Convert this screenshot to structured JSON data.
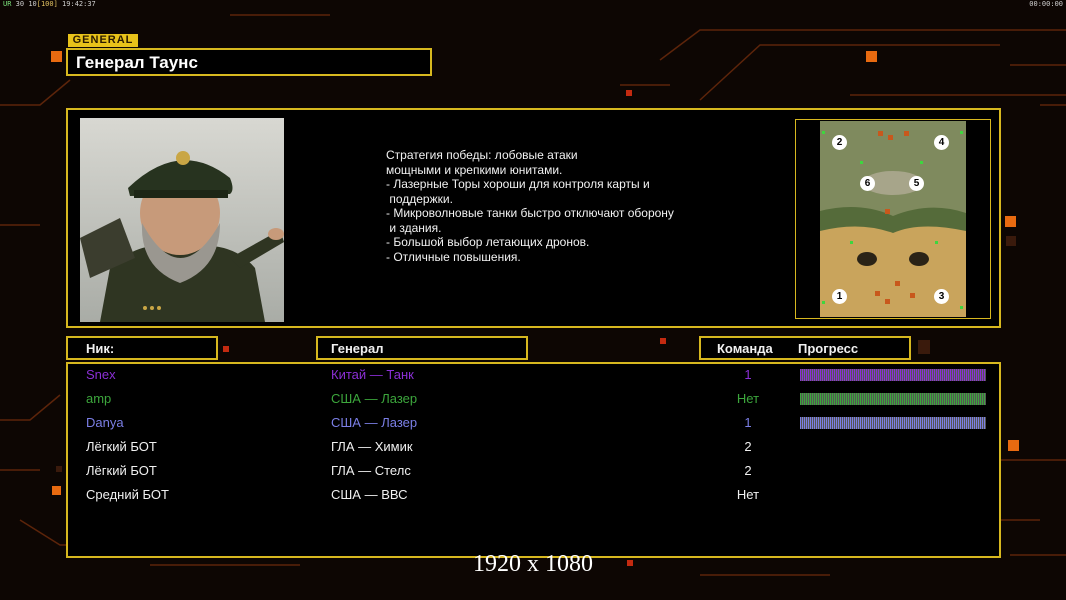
{
  "hud": {
    "left_a": "UR",
    "left_b": "30",
    "left_c": "10",
    "left_d": "[100]",
    "left_time": "19:42:37",
    "right_time": "00:00:00"
  },
  "general": {
    "tag": "GENERAL",
    "name": "Генерал Таунс",
    "description": [
      "Стратегия победы: лобовые атаки",
      "мощными и крепкими юнитами.",
      "",
      "- Лазерные Торы хороши для контроля карты и",
      " поддержки.",
      "- Микроволновые танки быстро отключают оборону",
      " и здания.",
      "",
      "- Большой выбор летающих дронов.",
      "- Отличные повышения."
    ]
  },
  "minimap": {
    "slots": [
      "2",
      "4",
      "6",
      "5",
      "1",
      "3"
    ]
  },
  "table": {
    "headers": {
      "nick": "Ник:",
      "general": "Генерал",
      "team": "Команда",
      "progress": "Прогресс"
    },
    "rows": [
      {
        "nick": "Snex",
        "general": "Китай — Танк",
        "team": "1",
        "color": "#8b2fd6",
        "progress": 1.0
      },
      {
        "nick": "amp",
        "general": "США — Лазер",
        "team": "Нет",
        "color": "#3ca63c",
        "progress": 1.0
      },
      {
        "nick": "Danya",
        "general": "США — Лазер",
        "team": "1",
        "color": "#7b7fe6",
        "progress": 1.0
      },
      {
        "nick": "Лёгкий БОТ",
        "general": "ГЛА — Химик",
        "team": "2",
        "color": "#f0f0f0"
      },
      {
        "nick": "Лёгкий БОТ",
        "general": "ГЛА — Стелс",
        "team": "2",
        "color": "#f0f0f0"
      },
      {
        "nick": "Средний БОТ",
        "general": "США — ВВС",
        "team": "Нет",
        "color": "#f0f0f0"
      }
    ]
  },
  "resolution_label": "1920 x 1080",
  "colors": {
    "accent": "#d7b81f",
    "orange": "#e86a10"
  }
}
